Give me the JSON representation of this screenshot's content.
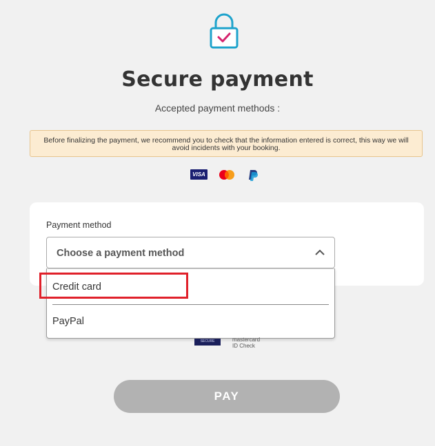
{
  "header": {
    "title": "Secure payment",
    "subtitle": "Accepted payment methods :"
  },
  "notice": {
    "text": "Before finalizing the payment, we recommend you to check that the information entered is correct, this way we will avoid incidents with your booking."
  },
  "brands": {
    "visa": "VISA"
  },
  "payment_form": {
    "label": "Payment method",
    "select_placeholder": "Choose a payment method",
    "options": [
      "Credit card",
      "PayPal"
    ]
  },
  "security_badges": {
    "secure_label": "SECURE",
    "mastercard_label": "mastercard",
    "id_check_label": "ID Check"
  },
  "pay_button": {
    "label": "PAY"
  },
  "colors": {
    "lock_body": "#1ea3cc",
    "lock_check": "#d6246e",
    "highlight": "#e0202a",
    "pay_disabled": "#b2b2b2"
  }
}
